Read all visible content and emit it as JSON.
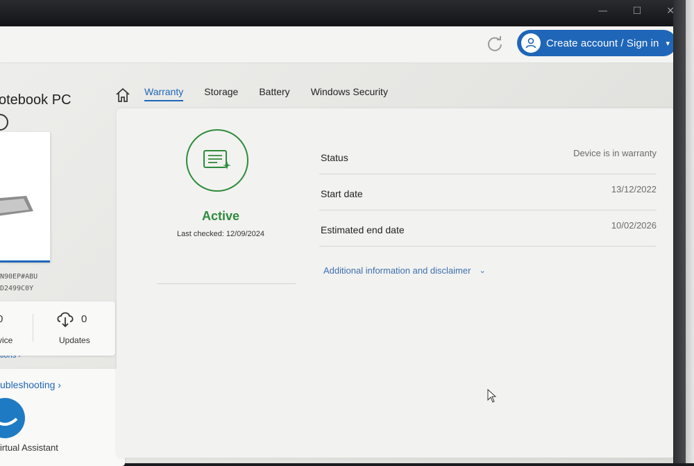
{
  "window_controls": [
    "—",
    "☐",
    "✕"
  ],
  "header": {
    "account_button": "Create account / Sign in"
  },
  "sidebar": {
    "device_name": "otebook PC",
    "options_link": "tions ›",
    "serial_line1": "N90EP#ABU",
    "serial_line2": "D2499C0Y",
    "stats": {
      "left_count": "0",
      "left_label": "vice",
      "updates_count": "0",
      "updates_label": "Updates"
    },
    "troubleshooting_link": "ubleshooting ›",
    "assistant_label": "irtual Assistant"
  },
  "tabs": [
    {
      "label": "Warranty",
      "active": true
    },
    {
      "label": "Storage",
      "active": false
    },
    {
      "label": "Battery",
      "active": false
    },
    {
      "label": "Windows Security",
      "active": false
    }
  ],
  "warranty": {
    "status_word": "Active",
    "last_checked": "Last checked: 12/09/2024",
    "rows": [
      {
        "label": "Status",
        "value": "Device is in warranty"
      },
      {
        "label": "Start date",
        "value": "13/12/2022"
      },
      {
        "label": "Estimated end date",
        "value": "10/02/2026"
      }
    ],
    "disclaimer_link": "Additional information and disclaimer"
  },
  "colors": {
    "accent_blue": "#1f66b8",
    "active_green": "#2e8b3a"
  },
  "icons": [
    "refresh-icon",
    "user-icon",
    "chevron-down-icon",
    "home-icon",
    "edit-icon",
    "cloud-download-icon",
    "certificate-icon",
    "virtual-assistant-icon",
    "mouse-cursor-icon"
  ]
}
